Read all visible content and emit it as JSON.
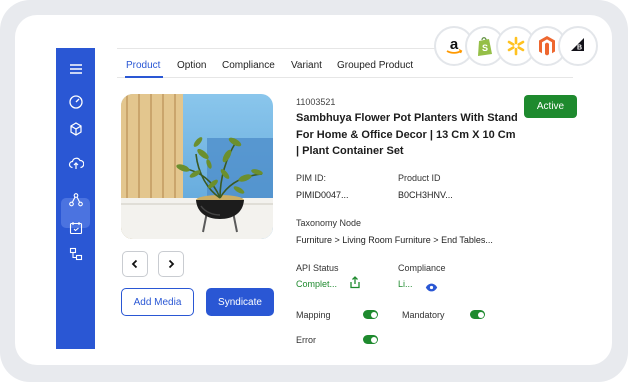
{
  "sidebar": {
    "items": [
      {
        "icon": "menu-icon"
      },
      {
        "icon": "dashboard-icon"
      },
      {
        "icon": "cube-icon"
      },
      {
        "icon": "upload-cloud-icon",
        "active": true
      },
      {
        "icon": "network-icon"
      },
      {
        "icon": "calendar-check-icon"
      },
      {
        "icon": "hierarchy-icon"
      }
    ]
  },
  "tabs": [
    {
      "label": "Product",
      "active": true
    },
    {
      "label": "Option"
    },
    {
      "label": "Compliance"
    },
    {
      "label": "Variant"
    },
    {
      "label": "Grouped Product"
    }
  ],
  "channels": [
    {
      "name": "amazon-icon"
    },
    {
      "name": "shopify-icon"
    },
    {
      "name": "walmart-icon"
    },
    {
      "name": "magento-icon"
    },
    {
      "name": "bigcommerce-icon"
    }
  ],
  "product": {
    "sku": "11003521",
    "title": "Sambhuya Flower Pot Planters With Stand For Home & Office Decor | 13 Cm X 10 Cm | Plant Container Set",
    "status": "Active",
    "pim_id_label": "PIM ID:",
    "pim_id": "PIMID0047...",
    "product_id_label": "Product ID",
    "product_id": "B0CH3HNV...",
    "taxonomy_label": "Taxonomy Node",
    "taxonomy": "Furniture > Living Room Furniture > End Tables...",
    "api_status_label": "API Status",
    "api_status": "Complet...",
    "compliance_label": "Compliance",
    "compliance": "Li...",
    "mapping_label": "Mapping",
    "mandatory_label": "Mandatory",
    "error_label": "Error"
  },
  "actions": {
    "add_media": "Add Media",
    "syndicate": "Syndicate"
  },
  "colors": {
    "primary": "#2a57d4",
    "success": "#1e8a2e"
  }
}
